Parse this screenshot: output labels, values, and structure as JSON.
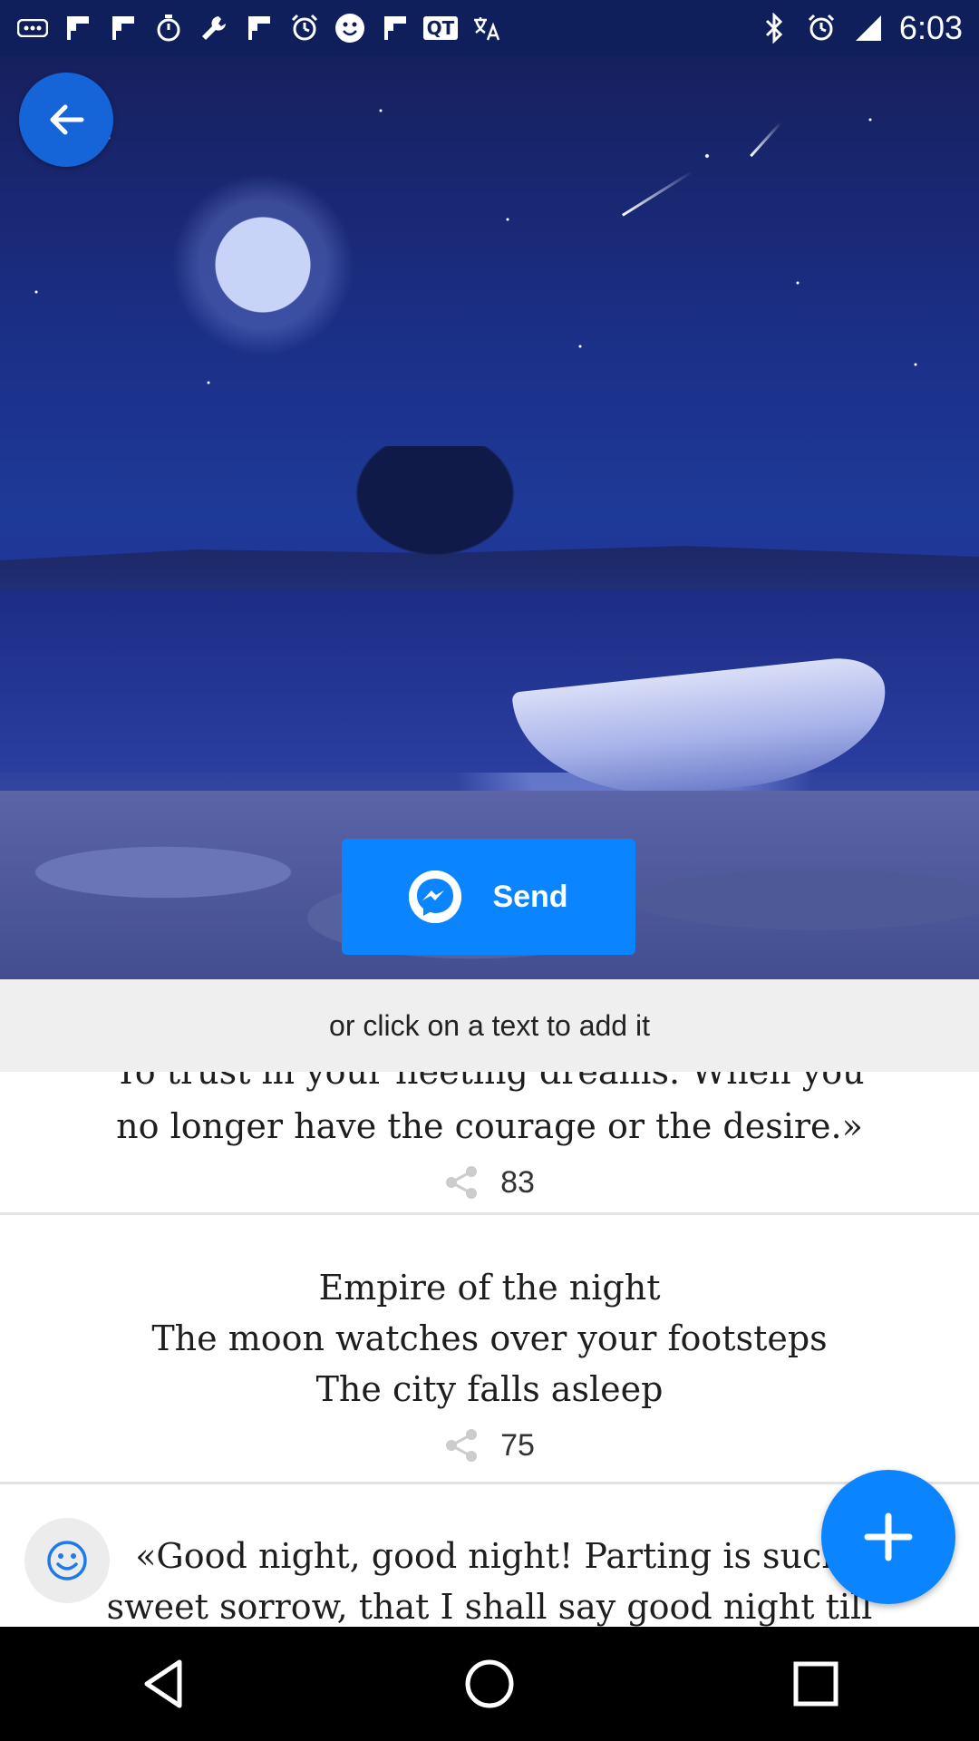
{
  "status_bar": {
    "time": "6:03",
    "left_icons": [
      "more-icon",
      "flipboard-icon",
      "flipboard-icon",
      "stopwatch-icon",
      "wrench-icon",
      "flipboard-icon",
      "alarm-icon",
      "smiley-icon",
      "flipboard-icon",
      "qt-icon",
      "translate-icon"
    ],
    "right_icons": [
      "bluetooth-icon",
      "alarm-icon",
      "signal-icon"
    ],
    "qt_label": "QT"
  },
  "hero": {
    "send_label": "Send"
  },
  "hint": {
    "text": "or click on a text to add it"
  },
  "quotes": [
    {
      "line_partial": "To trust in your fleeting dreams.  When you",
      "line": "no longer have the courage or the desire.»",
      "shares": "83"
    },
    {
      "lines": [
        "Empire of the night",
        "The moon watches over your footsteps",
        "The city falls asleep"
      ],
      "shares": "75"
    },
    {
      "lines": [
        "«Good night, good night! Parting is such",
        "sweet sorrow, that I shall say good night till"
      ]
    }
  ],
  "colors": {
    "accent": "#0a84ff",
    "back_button": "#1565d8",
    "hint_bg": "#efefef"
  }
}
